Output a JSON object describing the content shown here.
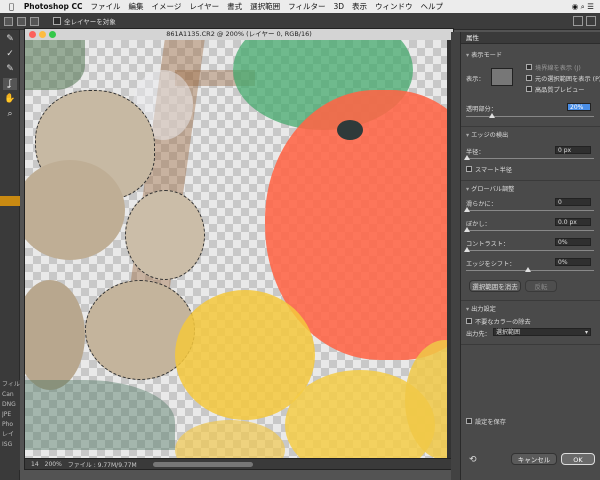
{
  "menubar": {
    "app_name": "Photoshop CC",
    "items": [
      "ファイル",
      "編集",
      "イメージ",
      "レイヤー",
      "書式",
      "選択範囲",
      "フィルター",
      "3D",
      "表示",
      "ウィンドウ",
      "ヘルプ"
    ]
  },
  "options_bar": {
    "sample_all_layers_label": "全レイヤーを対象"
  },
  "document": {
    "title": "861A1135.CR2 @ 200% (レイヤー 0, RGB/16)",
    "zoom": "200%",
    "file_info": "ファイル : 9.77M/9.77M",
    "left_frame_label": "14"
  },
  "left_strip": {
    "labels": [
      "フィル",
      "Can",
      "DNG",
      "JPE",
      "Pho",
      "レイ",
      "ISG"
    ]
  },
  "properties": {
    "title": "属性",
    "view_mode_label": "表示モード",
    "view_label": "表示：",
    "show_edge_label": "境界線を表示 (J)",
    "show_original_label": "元の選択範囲を表示 (P)",
    "high_quality_label": "高品質プレビュー",
    "opacity_label": "透明部分：",
    "opacity_value": "20%",
    "opacity_fraction": 0.2,
    "edge_detection_label": "エッジの検出",
    "radius_label": "半径：",
    "radius_value": "0 px",
    "smart_radius_label": "スマート半径",
    "global_refine_label": "グローバル調整",
    "smooth_label": "滑らかに：",
    "smooth_value": "0",
    "feather_label": "ぼかし：",
    "feather_value": "0.0 px",
    "contrast_label": "コントラスト：",
    "contrast_value": "0%",
    "shift_edge_label": "エッジをシフト：",
    "shift_edge_value": "0%",
    "clear_selection_label": "選択範囲を消去",
    "invert_label": "反転",
    "output_settings_label": "出力設定",
    "decontaminate_label": "不要なカラーの除去",
    "output_to_label": "出力先：",
    "output_to_value": "選択範囲",
    "remember_label": "設定を保存",
    "cancel_label": "キャンセル",
    "ok_label": "OK"
  },
  "colors": {
    "accent": "#4a8ee6",
    "overlay_red": "#ff6b4a",
    "tool_accent": "#c98a12"
  }
}
